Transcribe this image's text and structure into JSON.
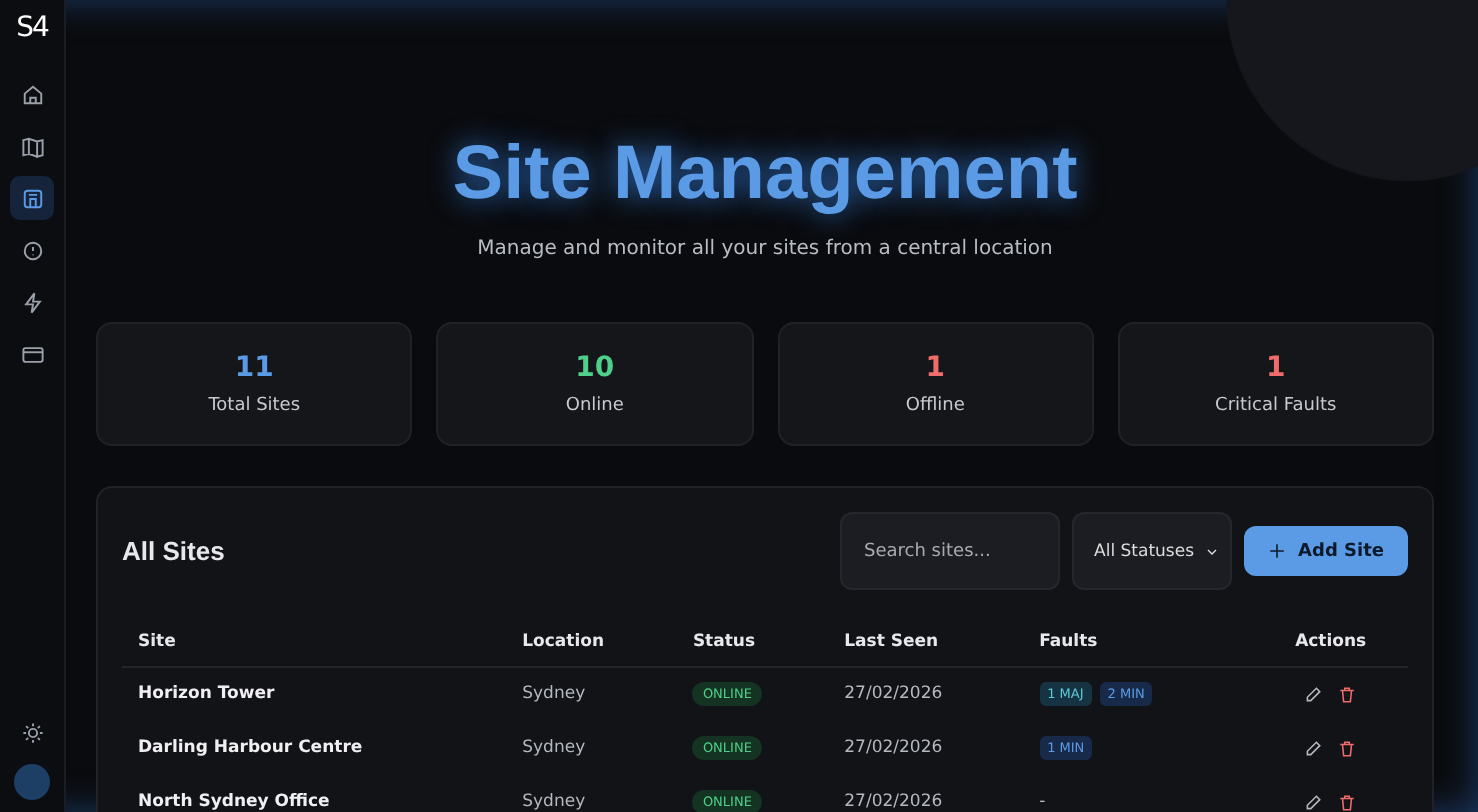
{
  "sidebar": {
    "logo": "S4",
    "items": [
      {
        "kind": "home",
        "selected": false
      },
      {
        "kind": "map",
        "selected": false
      },
      {
        "kind": "building",
        "selected": true
      },
      {
        "kind": "alert",
        "selected": false
      },
      {
        "kind": "bolt",
        "selected": false
      },
      {
        "kind": "card",
        "selected": false
      }
    ]
  },
  "header": {
    "title": "Site Management",
    "subtitle": "Manage and monitor all your sites from a central location"
  },
  "stats": [
    {
      "value": "11",
      "label": "Total Sites",
      "color": "#5b9be6"
    },
    {
      "value": "10",
      "label": "Online",
      "color": "#4fd08a"
    },
    {
      "value": "1",
      "label": "Offline",
      "color": "#f06b6b"
    },
    {
      "value": "1",
      "label": "Critical Faults",
      "color": "#f06b6b"
    }
  ],
  "sites_panel": {
    "title": "All Sites",
    "search": {
      "placeholder": "Search sites..."
    },
    "filter": {
      "value": "All Statuses"
    },
    "add_button": "Add Site",
    "table": {
      "columns": [
        "Site",
        "Location",
        "Status",
        "Last Seen",
        "Faults",
        "Actions"
      ],
      "rows": [
        {
          "site": "Horizon Tower",
          "location": "Sydney",
          "status": {
            "label": "ONLINE",
            "kind": "online"
          },
          "last_seen": "27/02/2026",
          "faults": [
            {
              "label": "1 MAJ",
              "kind": "major"
            },
            {
              "label": "2 MIN",
              "kind": "minor"
            }
          ]
        },
        {
          "site": "Darling Harbour Centre",
          "location": "Sydney",
          "status": {
            "label": "ONLINE",
            "kind": "online"
          },
          "last_seen": "27/02/2026",
          "faults": [
            {
              "label": "1 MIN",
              "kind": "minor"
            }
          ]
        },
        {
          "site": "North Sydney Office",
          "location": "Sydney",
          "status": {
            "label": "ONLINE",
            "kind": "online"
          },
          "last_seen": "27/02/2026",
          "faults": [],
          "no_faults": "-"
        }
      ]
    }
  }
}
